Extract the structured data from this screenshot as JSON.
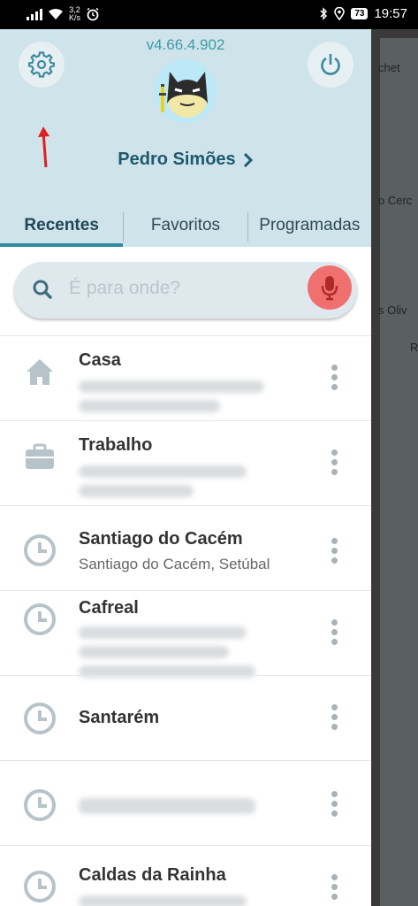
{
  "statusbar": {
    "speed_value": "3,2",
    "speed_unit": "K/s",
    "battery": "73",
    "time": "19:57"
  },
  "header": {
    "version": "v4.66.4.902",
    "username": "Pedro Simões"
  },
  "tabs": [
    {
      "label": "Recentes",
      "active": true
    },
    {
      "label": "Favoritos",
      "active": false
    },
    {
      "label": "Programadas",
      "active": false
    }
  ],
  "search": {
    "placeholder": "É para onde?"
  },
  "list": [
    {
      "icon": "home-icon",
      "title": "Casa"
    },
    {
      "icon": "briefcase-icon",
      "title": "Trabalho"
    },
    {
      "icon": "clock-icon",
      "title": "Santiago do Cacém",
      "subtitle": "Santiago do Cacém, Setúbal"
    },
    {
      "icon": "clock-icon",
      "title": "Cafreal"
    },
    {
      "icon": "clock-icon",
      "title": "Santarém"
    },
    {
      "icon": "clock-icon",
      "title": ""
    },
    {
      "icon": "clock-icon",
      "title": "Caldas da Rainha"
    }
  ],
  "map": {
    "labels": [
      "chet",
      "o Cerc",
      "s Oliv",
      "R"
    ]
  },
  "colors": {
    "header_bg": "#cfe3ea",
    "accent": "#2f8ba0",
    "mic": "#f07070"
  }
}
